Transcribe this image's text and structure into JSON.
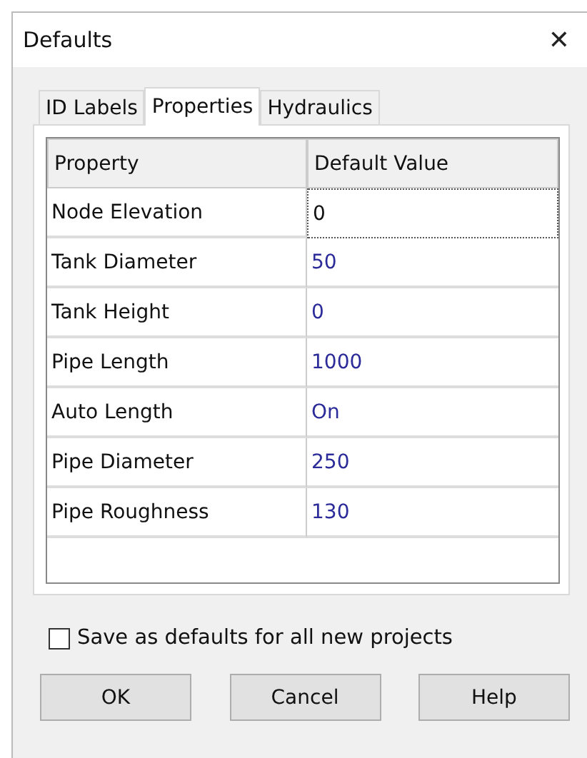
{
  "window": {
    "title": "Defaults",
    "close": "✕"
  },
  "tabs": [
    {
      "label": "ID Labels",
      "selected": false
    },
    {
      "label": "Properties",
      "selected": true
    },
    {
      "label": "Hydraulics",
      "selected": false
    }
  ],
  "table": {
    "columns": [
      "Property",
      "Default Value"
    ],
    "rows": [
      {
        "property": "Node Elevation",
        "value": "0",
        "focused": true
      },
      {
        "property": "Tank Diameter",
        "value": "50",
        "focused": false
      },
      {
        "property": "Tank Height",
        "value": "0",
        "focused": false
      },
      {
        "property": "Pipe Length",
        "value": "1000",
        "focused": false
      },
      {
        "property": "Auto Length",
        "value": "On",
        "focused": false
      },
      {
        "property": "Pipe Diameter",
        "value": "250",
        "focused": false
      },
      {
        "property": "Pipe Roughness",
        "value": "130",
        "focused": false
      }
    ]
  },
  "save_defaults": {
    "label": "Save as defaults for all new projects",
    "checked": false
  },
  "buttons": [
    "OK",
    "Cancel",
    "Help"
  ]
}
